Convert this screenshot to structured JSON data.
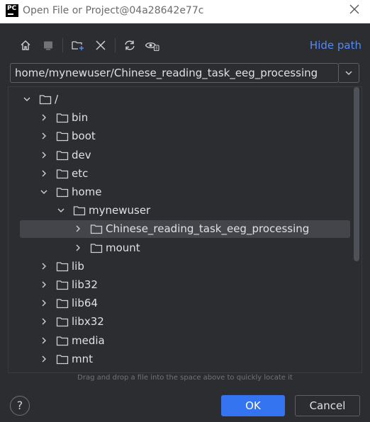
{
  "window": {
    "title": "Open File or Project@04a28642e77c",
    "logo_text": "PC"
  },
  "toolbar": {
    "icons": [
      "home-icon",
      "desktop-icon",
      "new-folder-icon",
      "delete-icon",
      "refresh-icon",
      "show-hidden-icon"
    ],
    "hide_path_label": "Hide path"
  },
  "path_field": {
    "value": "home/mynewuser/Chinese_reading_task_eeg_processing"
  },
  "tree": [
    {
      "label": "/",
      "depth": 0,
      "expanded": true
    },
    {
      "label": "bin",
      "depth": 1,
      "expanded": false
    },
    {
      "label": "boot",
      "depth": 1,
      "expanded": false
    },
    {
      "label": "dev",
      "depth": 1,
      "expanded": false
    },
    {
      "label": "etc",
      "depth": 1,
      "expanded": false
    },
    {
      "label": "home",
      "depth": 1,
      "expanded": true
    },
    {
      "label": "mynewuser",
      "depth": 2,
      "expanded": true
    },
    {
      "label": "Chinese_reading_task_eeg_processing",
      "depth": 3,
      "expanded": false,
      "selected": true
    },
    {
      "label": "mount",
      "depth": 3,
      "expanded": false
    },
    {
      "label": "lib",
      "depth": 1,
      "expanded": false
    },
    {
      "label": "lib32",
      "depth": 1,
      "expanded": false
    },
    {
      "label": "lib64",
      "depth": 1,
      "expanded": false
    },
    {
      "label": "libx32",
      "depth": 1,
      "expanded": false
    },
    {
      "label": "media",
      "depth": 1,
      "expanded": false
    },
    {
      "label": "mnt",
      "depth": 1,
      "expanded": false
    },
    {
      "label": "",
      "depth": 1,
      "expanded": false
    }
  ],
  "hint": "Drag and drop a file into the space above to quickly locate it",
  "buttons": {
    "help": "?",
    "ok": "OK",
    "cancel": "Cancel"
  },
  "colors": {
    "accent": "#3574f0",
    "link": "#548af7",
    "background": "#2b2d30",
    "selection": "#43454a"
  }
}
